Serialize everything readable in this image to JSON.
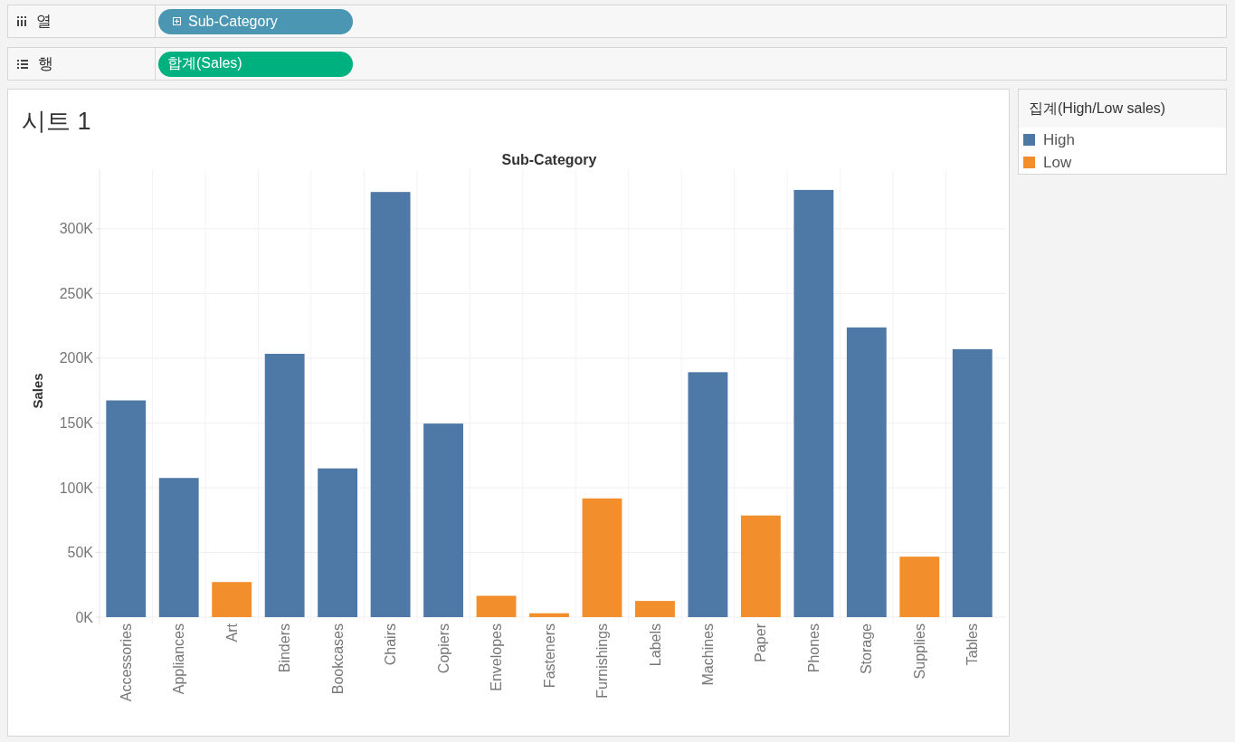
{
  "shelves": [
    {
      "kind": "columns",
      "label": "열",
      "pill": {
        "kind": "dimension",
        "text": "Sub-Category"
      }
    },
    {
      "kind": "rows",
      "label": "행",
      "pill": {
        "kind": "measure",
        "text": "합계(Sales)"
      }
    }
  ],
  "sheet": {
    "title": "시트 1",
    "chart_data": [
      {
        "type": "bar",
        "title": "Sub-Category",
        "ylabel": "Sales",
        "categories": [
          "Accessories",
          "Appliances",
          "Art",
          "Binders",
          "Bookcases",
          "Chairs",
          "Copiers",
          "Envelopes",
          "Fasteners",
          "Furnishings",
          "Labels",
          "Machines",
          "Paper",
          "Phones",
          "Storage",
          "Supplies",
          "Tables"
        ],
        "values": [
          167400,
          107500,
          27100,
          203400,
          114900,
          328400,
          149500,
          16500,
          3000,
          91700,
          12500,
          189200,
          78500,
          330000,
          223800,
          46700,
          207000
        ],
        "colors": [
          "#4e79a7",
          "#4e79a7",
          "#f28e2b",
          "#4e79a7",
          "#4e79a7",
          "#4e79a7",
          "#4e79a7",
          "#f28e2b",
          "#f28e2b",
          "#f28e2b",
          "#f28e2b",
          "#4e79a7",
          "#f28e2b",
          "#4e79a7",
          "#4e79a7",
          "#f28e2b",
          "#4e79a7"
        ],
        "ylim": [
          0,
          346000
        ],
        "yticks": [
          {
            "value": 0,
            "label": "0K"
          },
          {
            "value": 50000,
            "label": "50K"
          },
          {
            "value": 100000,
            "label": "100K"
          },
          {
            "value": 150000,
            "label": "150K"
          },
          {
            "value": 200000,
            "label": "200K"
          },
          {
            "value": 250000,
            "label": "250K"
          },
          {
            "value": 300000,
            "label": "300K"
          }
        ],
        "grid": true
      }
    ]
  },
  "legend": {
    "title": "집계(High/Low sales)",
    "items": [
      {
        "label": "High",
        "color": "#4e79a7"
      },
      {
        "label": "Low",
        "color": "#f28e2b"
      }
    ]
  }
}
